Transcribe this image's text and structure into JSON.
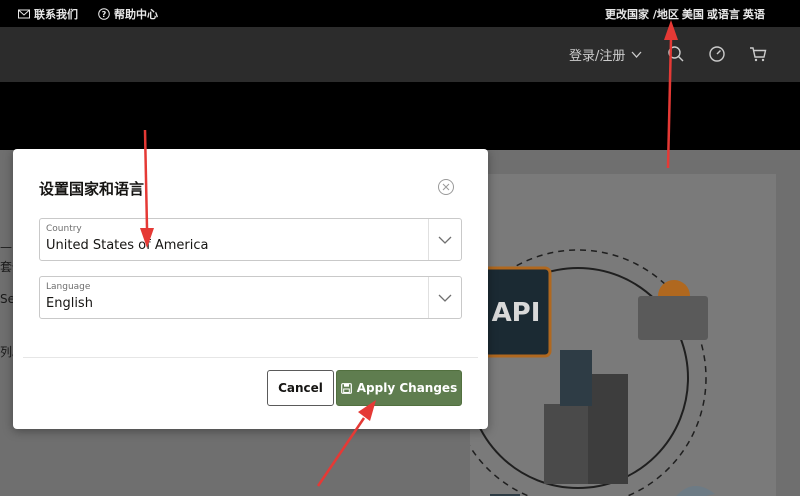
{
  "topbar": {
    "contact": "联系我们",
    "help": "帮助中心",
    "region_prefix": "更改国家 /地区",
    "region_value": "美国",
    "language_prefix": "或语言",
    "language_value": "英语"
  },
  "navbar": {
    "login": "登录/注册"
  },
  "page_snippets": [
    "—",
    "套件",
    "Se",
    "列。"
  ],
  "modal": {
    "title": "设置国家和语言",
    "country": {
      "label": "Country",
      "value": "United States of America"
    },
    "language": {
      "label": "Language",
      "value": "English"
    },
    "cancel_label": "Cancel",
    "apply_label": "Apply Changes"
  },
  "illustration": {
    "api_label": "API"
  },
  "colors": {
    "apply_button": "#5f7d4f",
    "annotation_arrow": "#e53935"
  }
}
